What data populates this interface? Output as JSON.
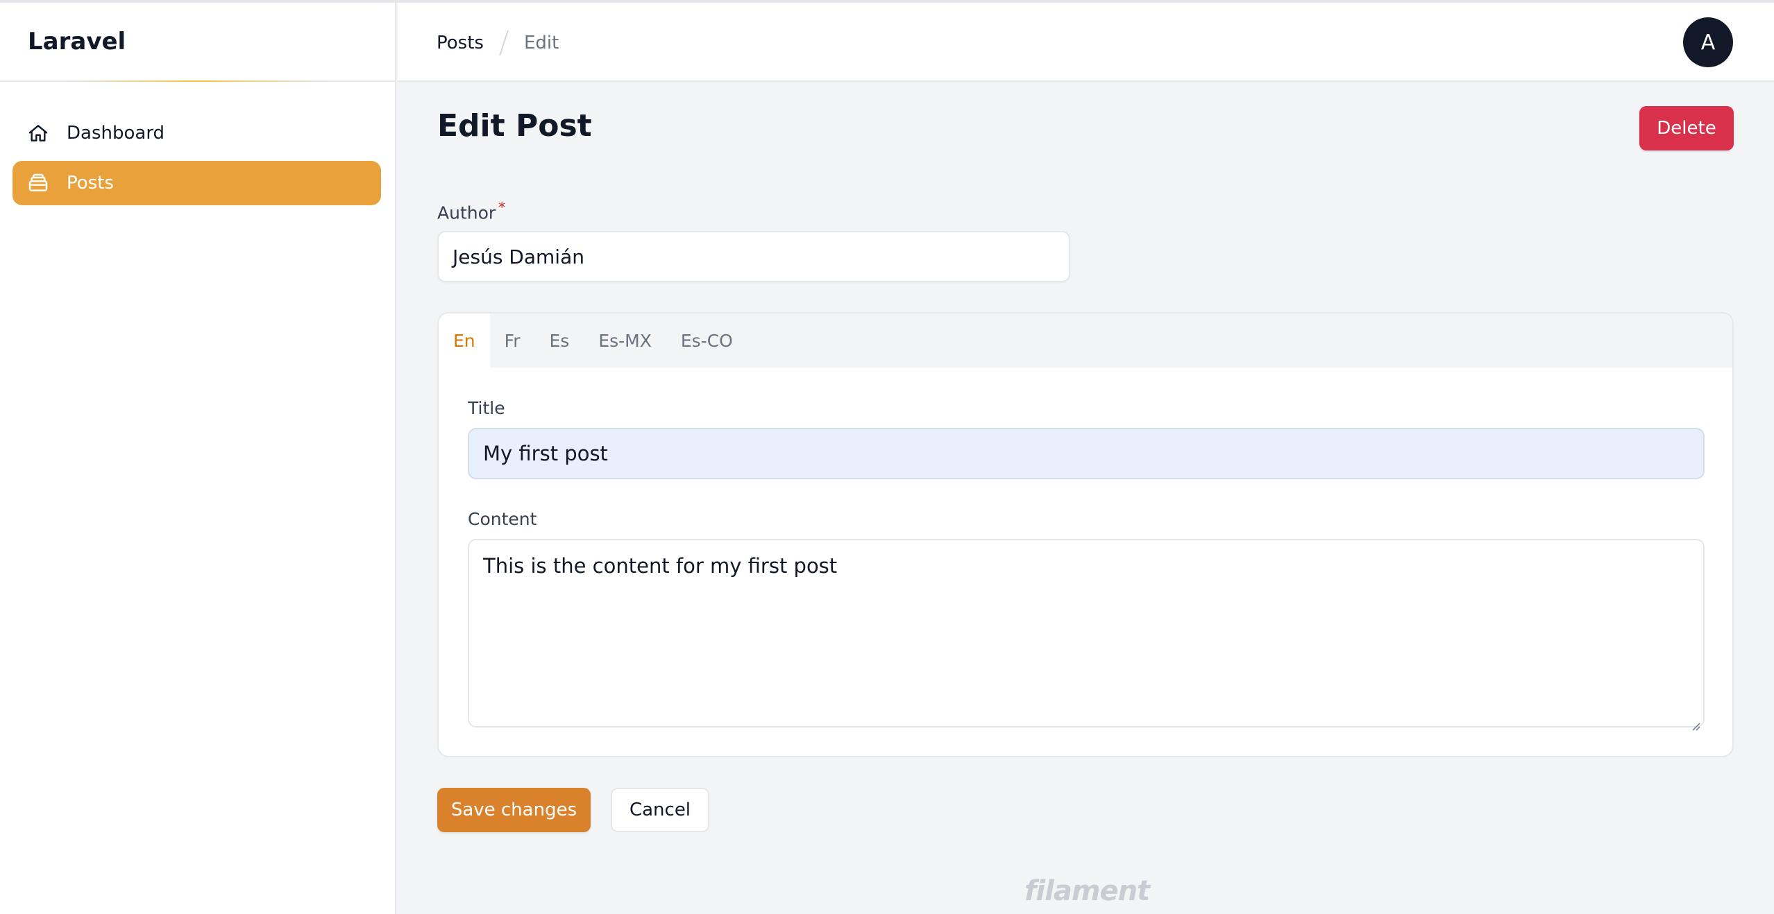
{
  "app": {
    "brand": "Laravel"
  },
  "sidebar": {
    "items": [
      {
        "label": "Dashboard",
        "icon": "home-icon",
        "active": false
      },
      {
        "label": "Posts",
        "icon": "archive-box-icon",
        "active": true
      }
    ]
  },
  "header": {
    "breadcrumb": [
      "Posts",
      "Edit"
    ],
    "avatar_initial": "A"
  },
  "page": {
    "title": "Edit Post",
    "delete_label": "Delete"
  },
  "form": {
    "author": {
      "label": "Author",
      "required_mark": "*",
      "value": "Jesús Damián"
    },
    "locale_tabs": [
      "En",
      "Fr",
      "Es",
      "Es-MX",
      "Es-CO"
    ],
    "active_tab": "En",
    "title": {
      "label": "Title",
      "value": "My first post"
    },
    "content": {
      "label": "Content",
      "value": "This is the content for my first post"
    },
    "save_label": "Save changes",
    "cancel_label": "Cancel"
  },
  "footer": {
    "logo_text": "filament"
  },
  "colors": {
    "primary": "#d9822b",
    "active_nav": "#e9a23b",
    "danger": "#d9304b",
    "active_tab_text": "#d97706"
  }
}
